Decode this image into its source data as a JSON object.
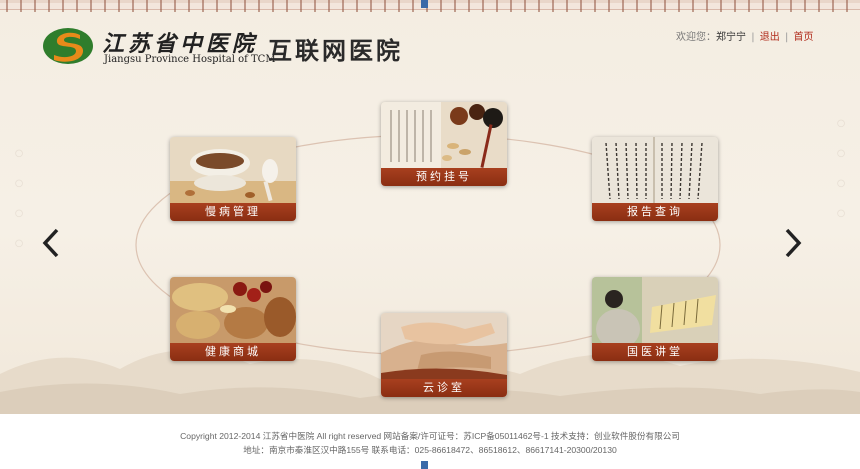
{
  "header": {
    "hospital_name_cn": "江苏省中医院",
    "hospital_name_en": "Jiangsu Province Hospital of TCM",
    "site_title": "互联网医院",
    "logo_icon": "tcm-hospital-logo-icon"
  },
  "user_bar": {
    "welcome": "欢迎您：",
    "username": "郑宁宁",
    "separator": "|",
    "logout": "退出",
    "home": "首页"
  },
  "modules": [
    {
      "label": "预约挂号",
      "icon": "scroll-herbs-photo"
    },
    {
      "label": "报告查询",
      "icon": "calligraphy-book-photo"
    },
    {
      "label": "国医讲堂",
      "icon": "scholar-scroll-photo"
    },
    {
      "label": "云诊室",
      "icon": "pulse-diagnosis-photo"
    },
    {
      "label": "健康商城",
      "icon": "herbal-ingredients-photo"
    },
    {
      "label": "慢病管理",
      "icon": "herbal-soup-photo"
    }
  ],
  "navigation": {
    "prev_icon": "chevron-left-icon",
    "next_icon": "chevron-right-icon"
  },
  "footer": {
    "line1": "Copyright 2012-2014 江苏省中医院 All right reserved 网站备案/许可证号：苏ICP备05011462号-1 技术支持：创业软件股份有限公司",
    "line2": "地址：南京市秦淮区汉中路155号 联系电话：025-86618472、86518612、86617141-20300/20130"
  },
  "colors": {
    "accent": "#b02a1a",
    "label_bar": "#9a3618",
    "background": "#f4ede2"
  }
}
